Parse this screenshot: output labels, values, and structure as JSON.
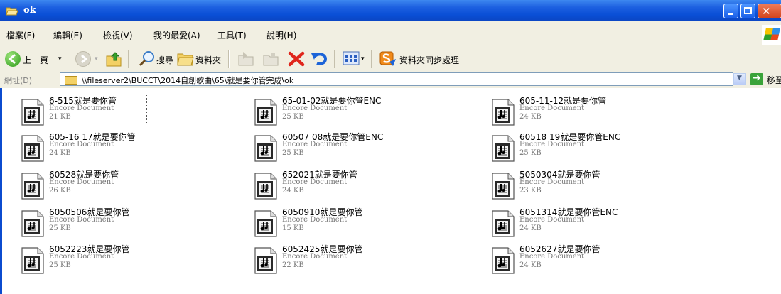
{
  "window": {
    "title": "ok",
    "close_glyph": "✕"
  },
  "menu": [
    "檔案(F)",
    "編輯(E)",
    "檢視(V)",
    "我的最愛(A)",
    "工具(T)",
    "說明(H)"
  ],
  "toolbar": {
    "back_label": "上一頁",
    "search_label": "搜尋",
    "folders_label": "資料夾",
    "sync_label": "資料夾同步處理"
  },
  "address": {
    "label": "網址(D)",
    "path": "\\\\fileserver2\\BUCCT\\2014自創歌曲\\65\\就是要你管完成\\ok",
    "go_label": "移至"
  },
  "files": [
    {
      "name": "6-515就是要你管",
      "type": "Encore Document",
      "size": "21 KB"
    },
    {
      "name": "65-01-02就是要你管ENC",
      "type": "Encore Document",
      "size": "25 KB"
    },
    {
      "name": "605-11-12就是要你管",
      "type": "Encore Document",
      "size": "24 KB"
    },
    {
      "name": "605-16 17就是要你管",
      "type": "Encore Document",
      "size": "24 KB"
    },
    {
      "name": "60507 08就是要你管ENC",
      "type": "Encore Document",
      "size": "25 KB"
    },
    {
      "name": "60518 19就是要你管ENC",
      "type": "Encore Document",
      "size": "25 KB"
    },
    {
      "name": "60528就是要你管",
      "type": "Encore Document",
      "size": "26 KB"
    },
    {
      "name": "652021就是要你管",
      "type": "Encore Document",
      "size": "24 KB"
    },
    {
      "name": "5050304就是要你管",
      "type": "Encore Document",
      "size": "23 KB"
    },
    {
      "name": "6050506就是要你管",
      "type": "Encore Document",
      "size": "25 KB"
    },
    {
      "name": "6050910就是要你管",
      "type": "Encore Document",
      "size": "15 KB"
    },
    {
      "name": "6051314就是要你管ENC",
      "type": "Encore Document",
      "size": "24 KB"
    },
    {
      "name": "6052223就是要你管",
      "type": "Encore Document",
      "size": "25 KB"
    },
    {
      "name": "6052425就是要你管",
      "type": "Encore Document",
      "size": "22 KB"
    },
    {
      "name": "6052627就是要你管",
      "type": "Encore Document",
      "size": "24 KB"
    }
  ]
}
